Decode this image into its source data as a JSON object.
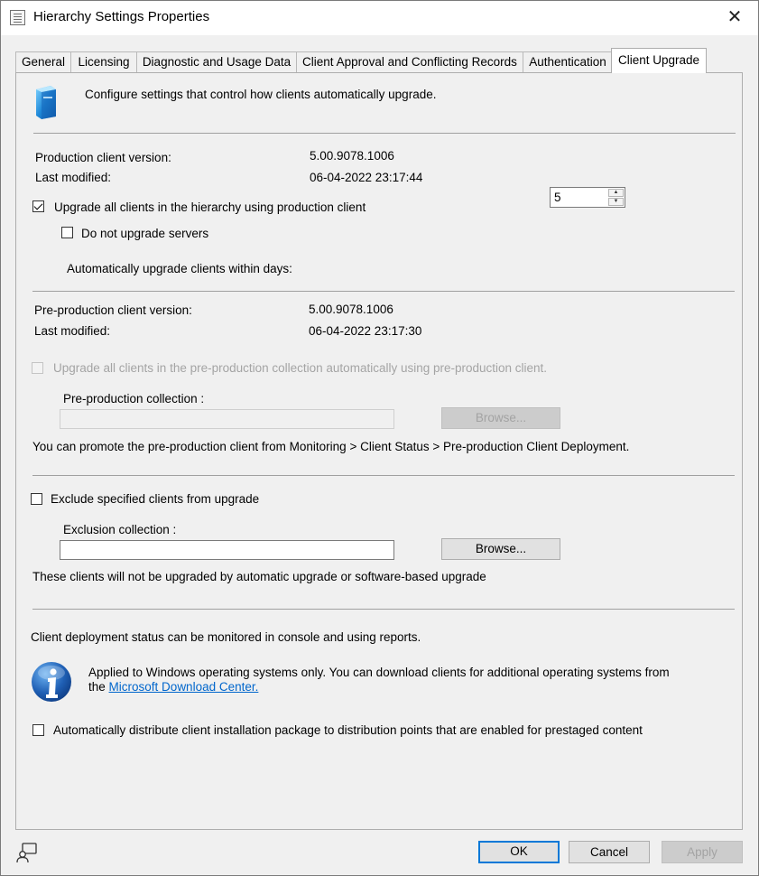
{
  "window": {
    "title": "Hierarchy Settings Properties",
    "close_glyph": "✕"
  },
  "tabs": [
    {
      "label": "General"
    },
    {
      "label": "Licensing"
    },
    {
      "label": "Diagnostic and Usage Data"
    },
    {
      "label": "Client Approval and Conflicting Records"
    },
    {
      "label": "Authentication"
    },
    {
      "label": "Client Upgrade",
      "active": true
    }
  ],
  "header": {
    "description": "Configure settings that control how clients automatically upgrade.",
    "icon": "computer-tower-icon"
  },
  "production": {
    "version_label": "Production client version:",
    "version_value": "5.00.9078.1006",
    "modified_label": "Last modified:",
    "modified_value": "06-04-2022 23:17:44",
    "upgrade_all_label": "Upgrade all clients in the hierarchy using production client",
    "upgrade_all_checked": true,
    "no_servers_label": "Do not upgrade servers",
    "no_servers_checked": false,
    "days_label": "Automatically upgrade clients within days:",
    "days_value": "5"
  },
  "preproduction": {
    "version_label": "Pre-production client version:",
    "version_value": "5.00.9078.1006",
    "modified_label": "Last modified:",
    "modified_value": "06-04-2022 23:17:30",
    "upgrade_label": "Upgrade all clients in the pre-production collection automatically using pre-production client.",
    "collection_label": "Pre-production collection :",
    "collection_value": "",
    "browse_label": "Browse...",
    "promote_note": "You can promote the pre-production client from Monitoring > Client Status > Pre-production Client Deployment."
  },
  "exclusion": {
    "exclude_label": "Exclude specified clients from upgrade",
    "exclude_checked": false,
    "collection_label": "Exclusion collection :",
    "collection_value": "",
    "browse_label": "Browse...",
    "note": "These clients will not be upgraded by automatic upgrade or software-based upgrade"
  },
  "deployment": {
    "monitor_note": "Client deployment status can be monitored in console and using reports.",
    "info_line1": "Applied to Windows operating systems only. You can download clients for additional operating systems from",
    "info_line2_prefix": "the",
    "info_link": "Microsoft Download Center.",
    "distribute_label": "Automatically distribute client installation package to distribution points that are enabled for prestaged content",
    "distribute_checked": false
  },
  "footer": {
    "ok_label": "OK",
    "cancel_label": "Cancel",
    "apply_label": "Apply",
    "help_icon": "feedback-icon"
  },
  "colors": {
    "accent": "#0078d7",
    "link": "#0066cc",
    "disabled_text": "#a4a4a4"
  }
}
